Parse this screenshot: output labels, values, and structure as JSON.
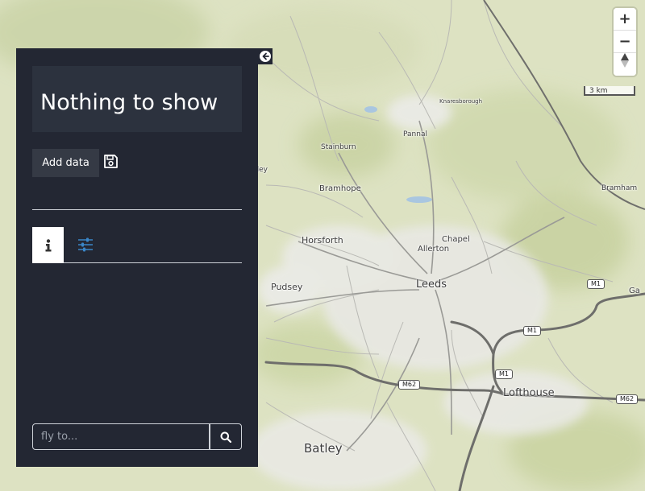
{
  "map": {
    "places": [
      {
        "id": "knaresborough",
        "label": "Knaresborough"
      },
      {
        "id": "pannal",
        "label": "Pannal"
      },
      {
        "id": "stainburn",
        "label": "Stainburn"
      },
      {
        "id": "otley",
        "label": "Otley"
      },
      {
        "id": "bramhope",
        "label": "Bramhope"
      },
      {
        "id": "bramham",
        "label": "Bramham"
      },
      {
        "id": "horsforth",
        "label": "Horsforth"
      },
      {
        "id": "chapel-allerton-1",
        "label": "Chapel"
      },
      {
        "id": "chapel-allerton-2",
        "label": "Allerton"
      },
      {
        "id": "pudsey",
        "label": "Pudsey"
      },
      {
        "id": "leeds",
        "label": "Leeds"
      },
      {
        "id": "lofthouse",
        "label": "Lofthouse"
      },
      {
        "id": "batley",
        "label": "Batley"
      },
      {
        "id": "garforth",
        "label": "Ga"
      }
    ],
    "road_shields": [
      "M1",
      "M1",
      "M1",
      "M62",
      "M62"
    ]
  },
  "controls": {
    "zoom_in": "+",
    "zoom_out": "−",
    "compass": "▲",
    "scale_label": "3 km"
  },
  "panel": {
    "title": "Nothing to show",
    "add_data_label": "Add data",
    "search_placeholder": "fly to...",
    "colors": {
      "panel_bg": "#232733",
      "title_bg": "#2c323e",
      "accent": "#3a86c8"
    }
  }
}
